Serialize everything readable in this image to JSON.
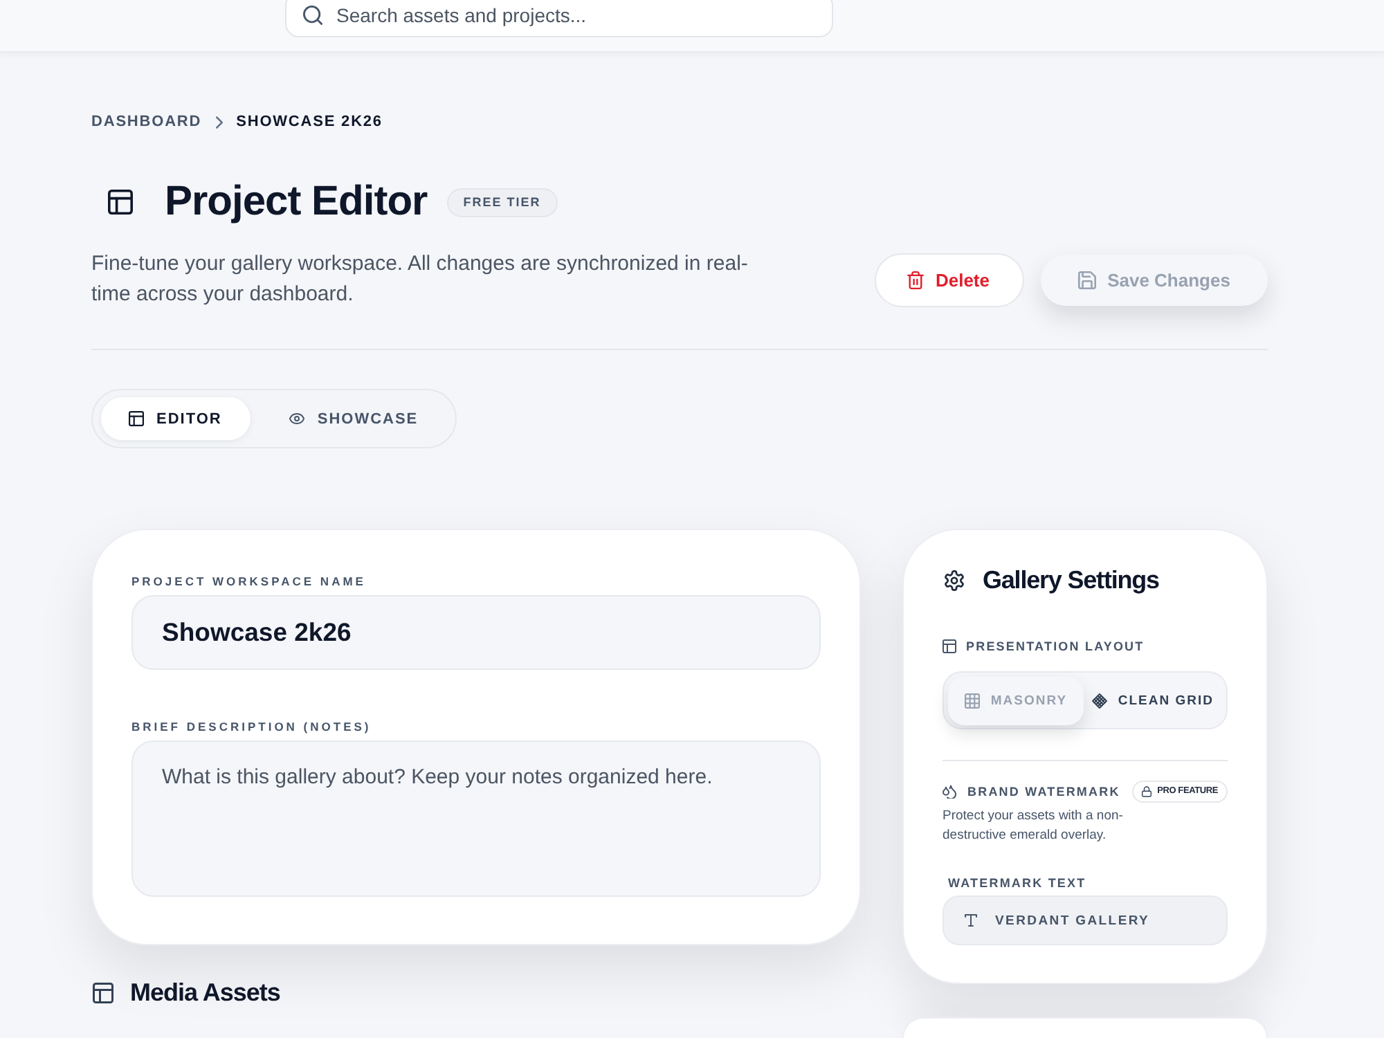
{
  "header": {
    "search": {
      "placeholder": "Search assets and projects..."
    }
  },
  "breadcrumb": [
    {
      "label": "DASHBOARD",
      "current": false
    },
    {
      "label": "SHOWCASE 2K26",
      "current": true
    }
  ],
  "page_header": {
    "title": "Project Editor",
    "badge": "FREE TIER",
    "description": "Fine-tune your gallery workspace. All changes are synchronized in real-time across your dashboard.",
    "actions": [
      {
        "label": "Delete",
        "kind": "danger"
      },
      {
        "label": "Save Changes",
        "kind": "primary"
      }
    ]
  },
  "tabs": [
    {
      "label": "EDITOR",
      "selected": true
    },
    {
      "label": "SHOWCASE",
      "selected": false
    }
  ],
  "project_card": {
    "fields": [
      {
        "label": "PROJECT WORKSPACE NAME",
        "kind": "input",
        "value": "Showcase 2k26"
      },
      {
        "label": "BRIEF DESCRIPTION (NOTES)",
        "kind": "textarea",
        "placeholder": "What is this gallery about? Keep your notes organized here."
      }
    ]
  },
  "media_assets": {
    "title": "Media Assets"
  },
  "gallery_settings": {
    "title": "Gallery Settings",
    "layout": {
      "label": "PRESENTATION LAYOUT",
      "options": [
        {
          "label": "MASONRY",
          "selected": true
        },
        {
          "label": "CLEAN GRID",
          "selected": false
        }
      ]
    },
    "watermark": {
      "title": "BRAND WATERMARK",
      "badge": "PRO FEATURE",
      "description": "Protect your assets with a non-destructive emerald overlay.",
      "field": {
        "label": "WATERMARK TEXT",
        "value": "VERDANT GALLERY"
      }
    }
  }
}
